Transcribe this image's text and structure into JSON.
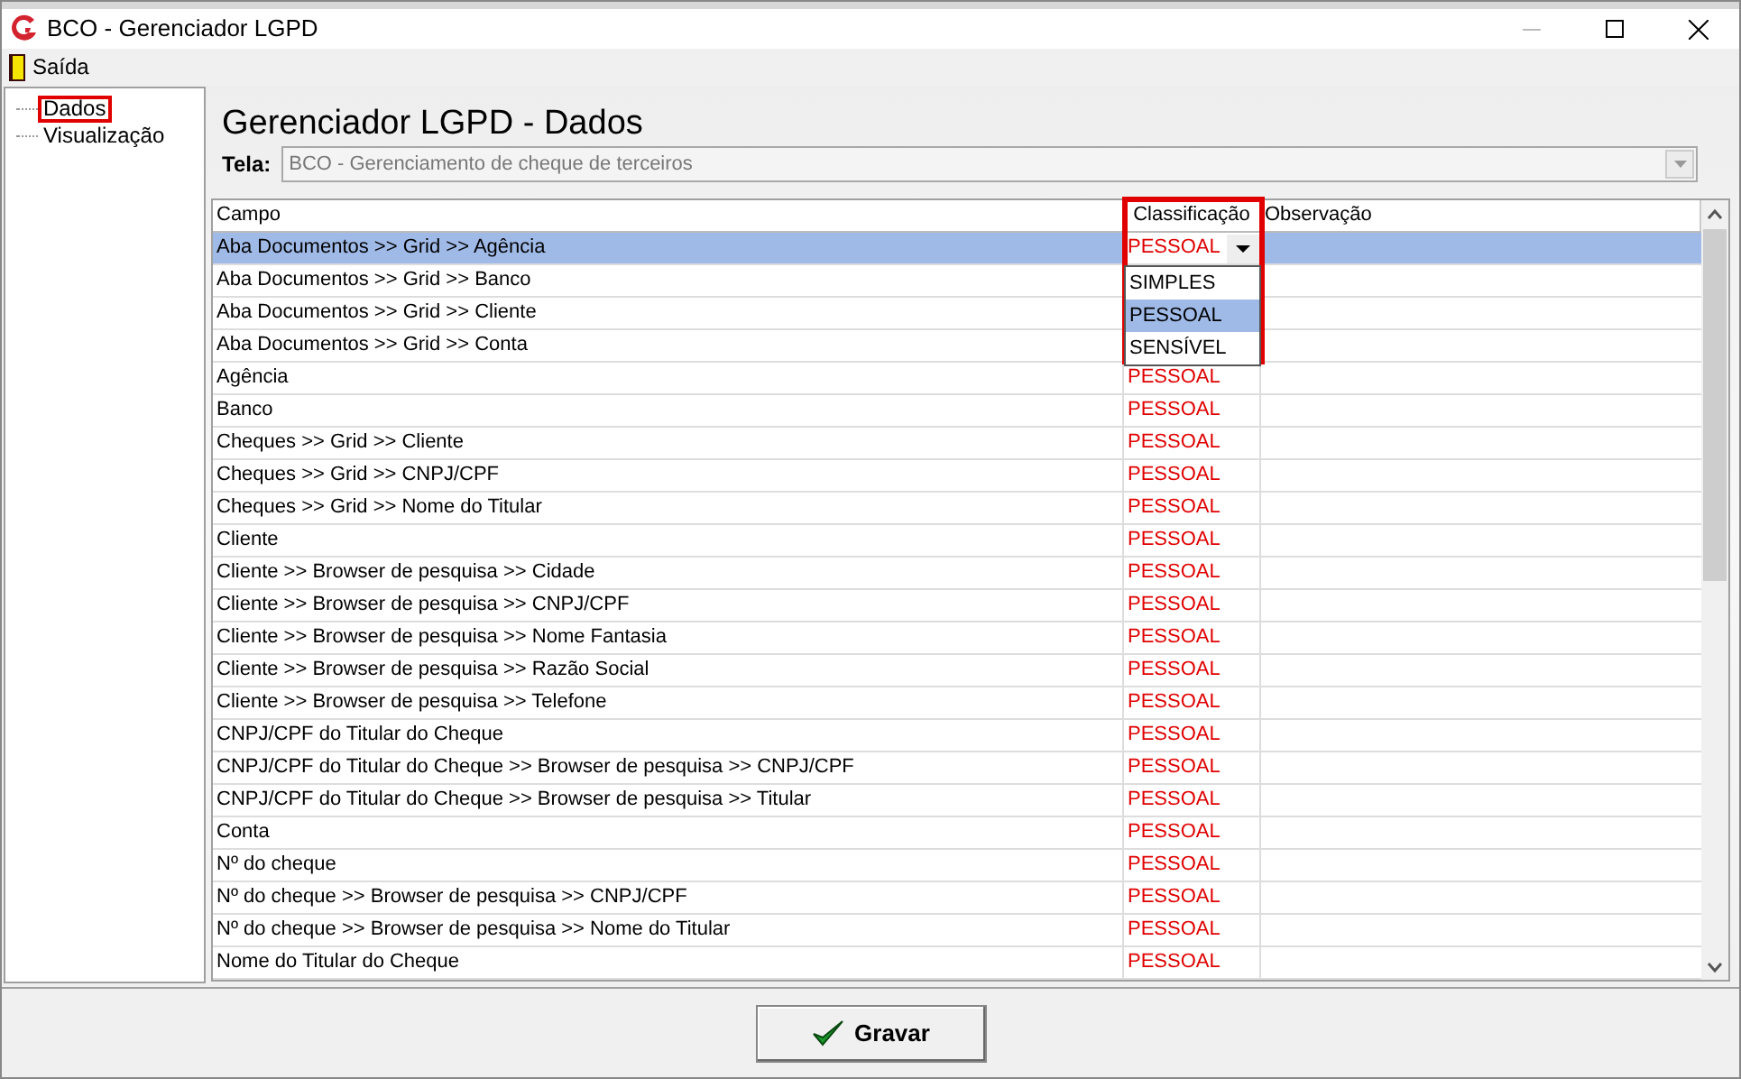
{
  "window": {
    "title": "BCO - Gerenciador LGPD"
  },
  "menu": [
    {
      "label": "Saída"
    }
  ],
  "tree": [
    {
      "label": "Dados",
      "highlighted": true
    },
    {
      "label": "Visualização",
      "highlighted": false
    }
  ],
  "heading": "Gerenciador LGPD - Dados",
  "screen_field": {
    "label": "Tela:",
    "value": "BCO - Gerenciamento de cheque de terceiros",
    "disabled": true
  },
  "table": {
    "columns": [
      "Campo",
      "Classificação",
      "Observação"
    ],
    "column_highlighted": true,
    "rows": [
      {
        "campo": "Aba Documentos >> Grid >> Agência",
        "classificacao": "PESSOAL",
        "selected": true
      },
      {
        "campo": "Aba Documentos >> Grid >> Banco",
        "selected": false
      },
      {
        "campo": "Aba Documentos >> Grid >> Cliente",
        "selected": false
      },
      {
        "campo": "Aba Documentos >> Grid >> Conta",
        "selected": false
      },
      {
        "campo": "Agência",
        "classificacao": "PESSOAL",
        "selected": false
      },
      {
        "campo": "Banco",
        "classificacao": "PESSOAL",
        "selected": false
      },
      {
        "campo": "Cheques >> Grid >> Cliente",
        "classificacao": "PESSOAL",
        "selected": false
      },
      {
        "campo": "Cheques >> Grid >> CNPJ/CPF",
        "classificacao": "PESSOAL",
        "selected": false
      },
      {
        "campo": "Cheques >> Grid >> Nome do Titular",
        "classificacao": "PESSOAL",
        "selected": false
      },
      {
        "campo": "Cliente",
        "classificacao": "PESSOAL",
        "selected": false
      },
      {
        "campo": "Cliente >> Browser de pesquisa >> Cidade",
        "classificacao": "PESSOAL",
        "selected": false
      },
      {
        "campo": "Cliente >> Browser de pesquisa >> CNPJ/CPF",
        "classificacao": "PESSOAL",
        "selected": false
      },
      {
        "campo": "Cliente >> Browser de pesquisa >> Nome Fantasia",
        "classificacao": "PESSOAL",
        "selected": false
      },
      {
        "campo": "Cliente >> Browser de pesquisa >> Razão Social",
        "classificacao": "PESSOAL",
        "selected": false
      },
      {
        "campo": "Cliente >> Browser de pesquisa >> Telefone",
        "classificacao": "PESSOAL",
        "selected": false
      },
      {
        "campo": "CNPJ/CPF do Titular do Cheque",
        "classificacao": "PESSOAL",
        "selected": false
      },
      {
        "campo": "CNPJ/CPF do Titular do Cheque >> Browser de pesquisa >> CNPJ/CPF",
        "classificacao": "PESSOAL",
        "selected": false
      },
      {
        "campo": "CNPJ/CPF do Titular do Cheque >> Browser de pesquisa >> Titular",
        "classificacao": "PESSOAL",
        "selected": false
      },
      {
        "campo": "Conta",
        "classificacao": "PESSOAL",
        "selected": false
      },
      {
        "campo": "Nº do cheque",
        "classificacao": "PESSOAL",
        "selected": false
      },
      {
        "campo": "Nº do cheque >> Browser de pesquisa >> CNPJ/CPF",
        "classificacao": "PESSOAL",
        "selected": false
      },
      {
        "campo": "Nº do cheque >> Browser de pesquisa >> Nome do Titular",
        "classificacao": "PESSOAL",
        "selected": false
      },
      {
        "campo": "Nome do Titular do Cheque",
        "classificacao": "PESSOAL",
        "selected": false
      }
    ]
  },
  "dropdown": {
    "options": [
      {
        "label": "SIMPLES",
        "selected": false
      },
      {
        "label": "PESSOAL",
        "selected": true
      },
      {
        "label": "SENSÍVEL",
        "selected": false
      }
    ]
  },
  "save_button": {
    "label": "Gravar"
  }
}
